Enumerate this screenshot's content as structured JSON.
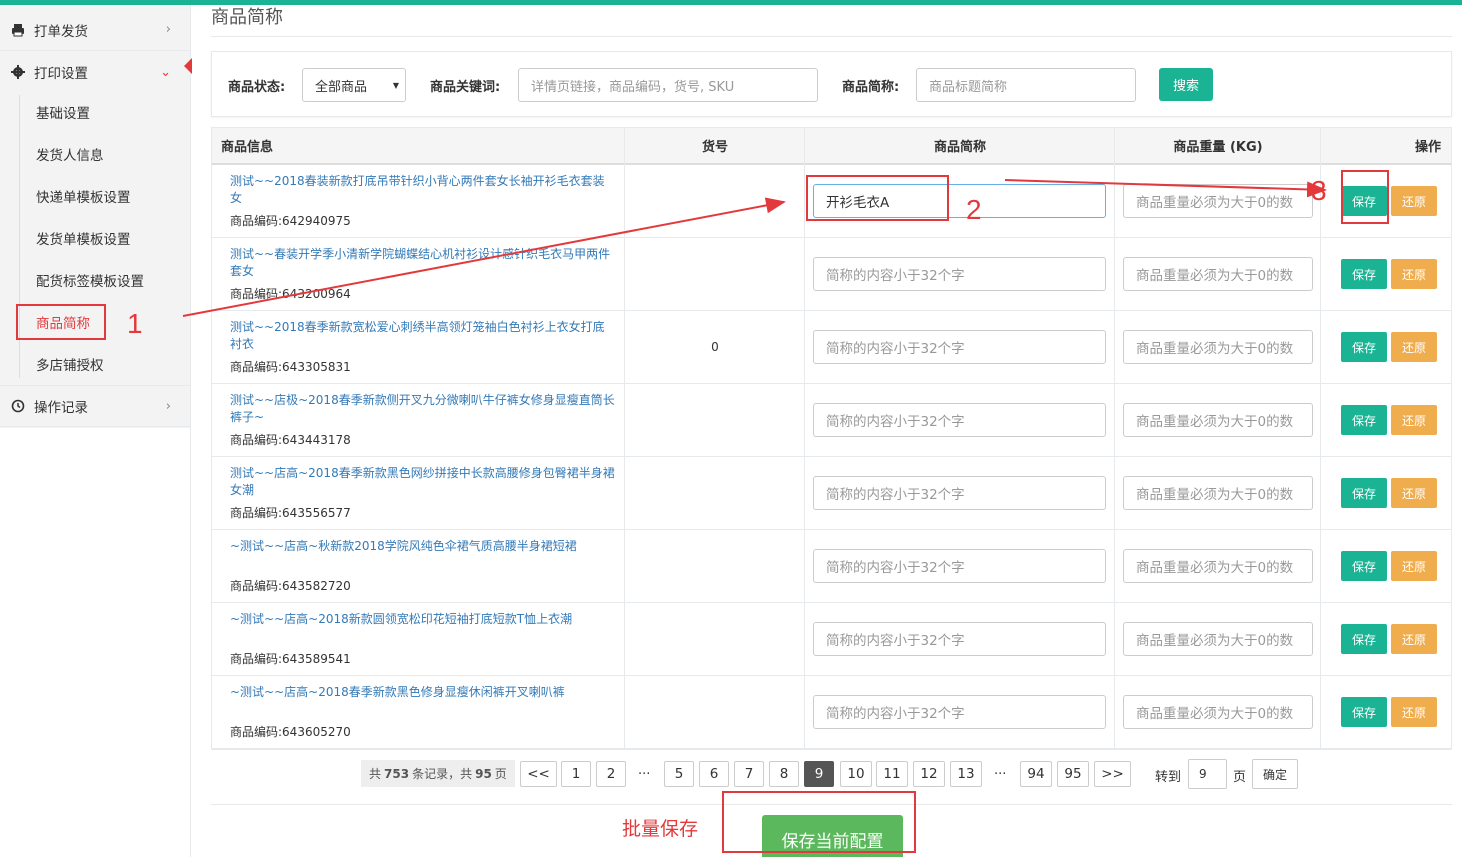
{
  "sidebar": {
    "top_items": [
      {
        "label": "打单发货",
        "icon": "printer-icon"
      },
      {
        "label": "打印设置",
        "icon": "gear-icon"
      }
    ],
    "sub_items": [
      "基础设置",
      "发货人信息",
      "快递单模板设置",
      "发货单模板设置",
      "配货标签模板设置",
      "商品简称",
      "多店铺授权"
    ],
    "bottom_item": {
      "label": "操作记录",
      "icon": "history-icon"
    }
  },
  "page": {
    "title": "商品简称"
  },
  "filter": {
    "status_label": "商品状态:",
    "status_value": "全部商品",
    "keyword_label": "商品关键词:",
    "keyword_placeholder": "详情页链接，商品编码，货号, SKU",
    "alias_label": "商品简称:",
    "alias_placeholder": "商品标题简称",
    "search_button": "搜索"
  },
  "table": {
    "headers": [
      "商品信息",
      "货号",
      "商品简称",
      "商品重量 (KG)",
      "操作"
    ],
    "name_placeholder": "简称的内容小于32个字",
    "weight_placeholder": "商品重量必须为大于0的数",
    "save_label": "保存",
    "reset_label": "还原",
    "rows": [
      {
        "title": "测试~~2018春装新款打底吊带针织小背心两件套女长袖开衫毛衣套装女",
        "code": "商品编码:642940975",
        "sku": "",
        "alias": "开衫毛衣A"
      },
      {
        "title": "测试~~春装开学季小清新学院蝴蝶结心机衬衫设计感针织毛衣马甲两件套女",
        "code": "商品编码:643200964",
        "sku": "",
        "alias": ""
      },
      {
        "title": "测试~~2018春季新款宽松爱心刺绣半高领灯笼袖白色衬衫上衣女打底衬衣",
        "code": "商品编码:643305831",
        "sku": "0",
        "alias": ""
      },
      {
        "title": "测试~~店极~2018春季新款侧开叉九分微喇叭牛仔裤女修身显瘦直筒长裤子~",
        "code": "商品编码:643443178",
        "sku": "",
        "alias": ""
      },
      {
        "title": "测试~~店高~2018春季新款黑色网纱拼接中长款高腰修身包臀裙半身裙女潮",
        "code": "商品编码:643556577",
        "sku": "",
        "alias": ""
      },
      {
        "title": "~测试~~店高~秋新款2018学院风纯色伞裙气质高腰半身裙短裙",
        "code": "商品编码:643582720",
        "sku": "",
        "alias": ""
      },
      {
        "title": "~测试~~店高~2018新款圆领宽松印花短袖打底短款T恤上衣潮",
        "code": "商品编码:643589541",
        "sku": "",
        "alias": ""
      },
      {
        "title": "~测试~~店高~2018春季新款黑色修身显瘦休闲裤开叉喇叭裤",
        "code": "商品编码:643605270",
        "sku": "",
        "alias": ""
      }
    ]
  },
  "pagination": {
    "info_prefix": "共",
    "total_records": "753",
    "info_mid": "条记录，共",
    "total_pages": "95",
    "info_suffix": "页",
    "prev": "<<",
    "next": ">>",
    "pages": [
      "1",
      "2",
      "...",
      "5",
      "6",
      "7",
      "8",
      "9",
      "10",
      "11",
      "12",
      "13",
      "...",
      "94",
      "95"
    ],
    "current": "9",
    "goto_label": "转到",
    "goto_value": "9",
    "page_unit": "页",
    "confirm": "确定"
  },
  "footer": {
    "save_all": "保存当前配置"
  },
  "annotations": {
    "n1": "1",
    "n2": "2",
    "n3": "3",
    "batch_save": "批量保存"
  },
  "colors": {
    "accent": "#1ab394",
    "warning": "#f0ad4e",
    "success": "#5cb85c",
    "annotation": "#e4393c",
    "link": "#337ab7"
  }
}
